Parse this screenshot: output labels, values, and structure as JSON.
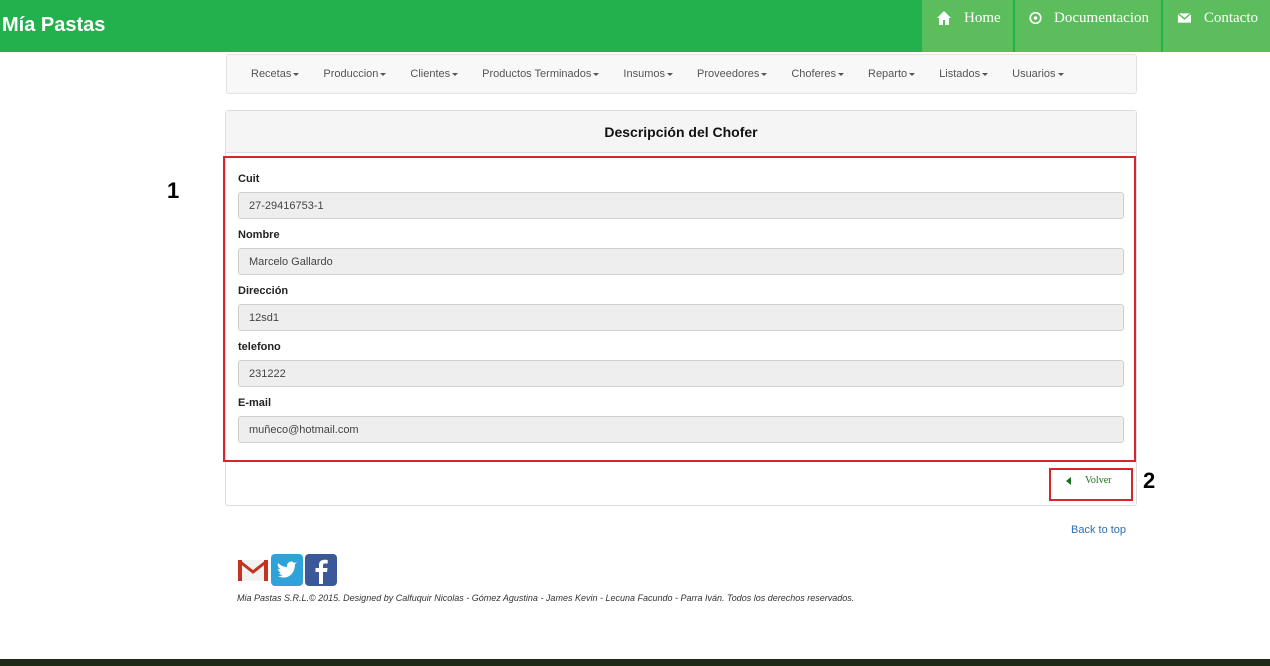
{
  "brand": "Mía Pastas",
  "topnav": {
    "home": "Home",
    "documentacion": "Documentacion",
    "contacto": "Contacto"
  },
  "menu": [
    "Recetas",
    "Produccion",
    "Clientes",
    "Productos Terminados",
    "Insumos",
    "Proveedores",
    "Choferes",
    "Reparto",
    "Listados",
    "Usuarios"
  ],
  "panel": {
    "title": "Descripción del Chofer",
    "fields": [
      {
        "label": "Cuit",
        "value": "27-29416753-1"
      },
      {
        "label": "Nombre",
        "value": "Marcelo Gallardo"
      },
      {
        "label": "Dirección",
        "value": "12sd1"
      },
      {
        "label": "telefono",
        "value": "231222"
      },
      {
        "label": "E-mail",
        "value": "muñeco@hotmail.com"
      }
    ],
    "back_button": "Volver"
  },
  "annotations": {
    "n1": "1",
    "n2": "2"
  },
  "back_to_top": "Back to top",
  "footer": "Mia Pastas S.R.L.© 2015. Designed by Calfuquir Nicolas - Gómez Agustina - James Kevin - Lecuna Facundo - Parra Iván. Todos los derechos reservados.",
  "colors": {
    "header": "#22b14c",
    "nav_item": "#5cbd5c",
    "annotation_box": "#d9242b",
    "link": "#2a6fb0"
  }
}
